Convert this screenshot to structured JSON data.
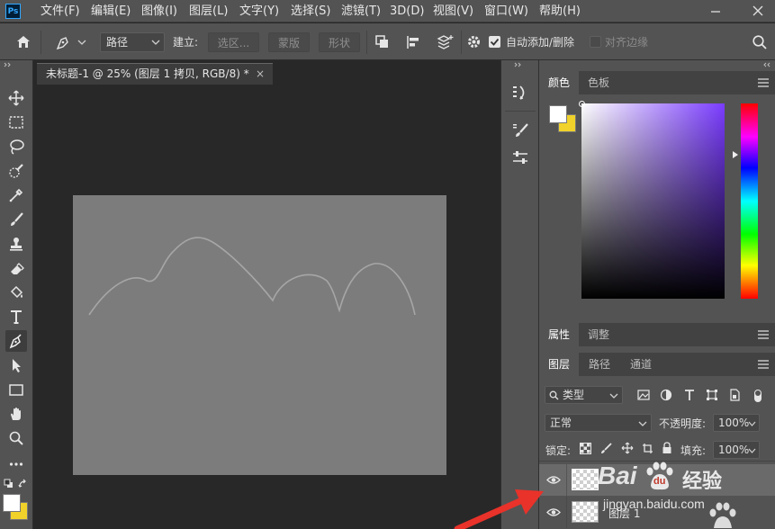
{
  "app": {
    "logo_text": "Ps"
  },
  "menu": [
    "文件(F)",
    "编辑(E)",
    "图像(I)",
    "图层(L)",
    "文字(Y)",
    "选择(S)",
    "滤镜(T)",
    "3D(D)",
    "视图(V)",
    "窗口(W)",
    "帮助(H)"
  ],
  "options_bar": {
    "mode_value": "路径",
    "build_label": "建立:",
    "selection_label": "选区...",
    "mask_label": "蒙版",
    "shape_label": "形状",
    "auto_add_delete_label": "自动添加/删除",
    "auto_add_delete_checked": true,
    "align_edges_label": "对齐边缘",
    "align_edges_checked": false
  },
  "document": {
    "tab_title": "未标题-1 @ 25% (图层 1 拷贝, RGB/8) *",
    "close_glyph": "×"
  },
  "color_panel": {
    "tabs": [
      "颜色",
      "色板"
    ],
    "foreground": "#ffffff",
    "background": "#f0d22a",
    "hue_color": "#7a3cff"
  },
  "properties_panel": {
    "tabs": [
      "属性",
      "调整"
    ]
  },
  "layers_panel": {
    "tabs": [
      "图层",
      "路径",
      "通道"
    ],
    "filter_kind": "类型",
    "blend_mode": "正常",
    "opacity_label": "不透明度:",
    "opacity_value": "100%",
    "lock_label": "锁定:",
    "fill_label": "填充:",
    "fill_value": "100%",
    "layers": [
      {
        "name": "",
        "selected": true,
        "visible": true
      },
      {
        "name": "图层 1",
        "selected": false,
        "visible": true
      }
    ]
  },
  "watermark": {
    "brand": "Bai",
    "paw_text": "du",
    "product": "经验",
    "url": "jingyan.baidu.com"
  },
  "colors": {
    "accent": "#31a8ff",
    "arrow": "#e8322a",
    "curve": "#a6a6a6"
  }
}
